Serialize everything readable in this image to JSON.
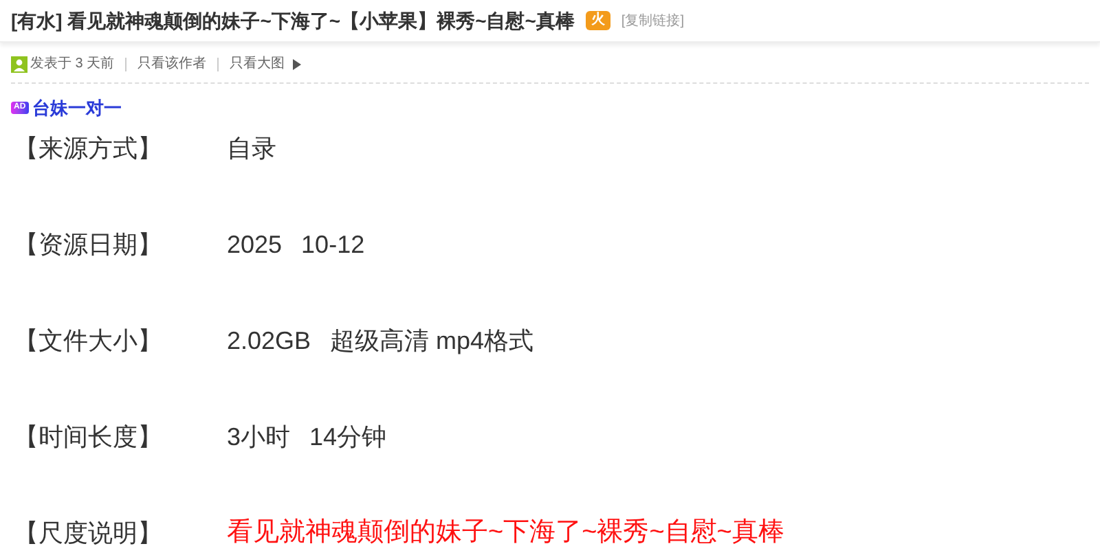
{
  "thread": {
    "prefix": "[有水]",
    "title": "看见就神魂颠倒的妹子~下海了~【小苹果】裸秀~自慰~真棒",
    "hot_badge": "火",
    "copy_link": "[复制链接]"
  },
  "meta": {
    "posted": "发表于 3 天前",
    "links": [
      "只看该作者",
      "只看大图"
    ]
  },
  "ad": {
    "badge": "AD",
    "text": "台妹一对一"
  },
  "fields": [
    {
      "label": "【来源方式】",
      "values": [
        "自录"
      ],
      "emphasized": false
    },
    {
      "label": "【资源日期】",
      "values": [
        "2025",
        "10-12"
      ],
      "emphasized": false
    },
    {
      "label": "【文件大小】",
      "values": [
        "2.02GB",
        "超级高清 mp4格式"
      ],
      "emphasized": false
    },
    {
      "label": "【时间长度】",
      "values": [
        "3小时",
        "14分钟"
      ],
      "emphasized": false
    },
    {
      "label": "【尺度说明】",
      "values": [
        "看见就神魂颠倒的妹子~下海了~裸秀~自慰~真棒"
      ],
      "emphasized": true
    }
  ]
}
